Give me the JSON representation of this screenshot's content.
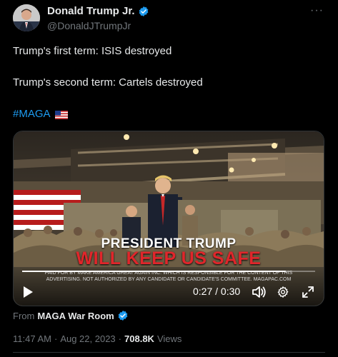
{
  "author": {
    "display_name": "Donald Trump Jr.",
    "handle": "@DonaldJTrumpJr",
    "more_label": "···"
  },
  "tweet": {
    "line1": "Trump's first term: ISIS destroyed",
    "line2": "Trump's second term: Cartels destroyed",
    "hashtag": "#MAGA"
  },
  "video": {
    "overlay_line1": "PRESIDENT TRUMP",
    "overlay_line2": "WILL KEEP US SAFE",
    "disclaimer_line1": "PAID FOR BY MAKE AMERICA GREAT AGAIN INC. WHICH IS RESPONSIBLE FOR THE CONTENT OF THIS",
    "disclaimer_line2": "ADVERTISING. NOT AUTHORIZED BY ANY CANDIDATE OR CANDIDATE'S COMMITTEE. MAGAPAC.COM",
    "time_display": "0:27 / 0:30",
    "progress_fraction": 0.9
  },
  "source": {
    "prefix": "From",
    "name": "MAGA War Room"
  },
  "meta": {
    "time": "11:47 AM",
    "separator1": "·",
    "date": "Aug 22, 2023",
    "separator2": "·",
    "views_count": "708.8K",
    "views_label": "Views"
  },
  "colors": {
    "background": "#000000",
    "text": "#e7e9ea",
    "muted": "#71767b",
    "link": "#1d9bf0",
    "verified": "#1d9bf0",
    "overlay_red": "#e0262b"
  },
  "icons": {
    "verified": "verified-badge-icon",
    "flag": "us-flag-icon",
    "play": "play-icon",
    "volume": "volume-icon",
    "settings": "gear-icon",
    "fullscreen": "fullscreen-icon"
  }
}
